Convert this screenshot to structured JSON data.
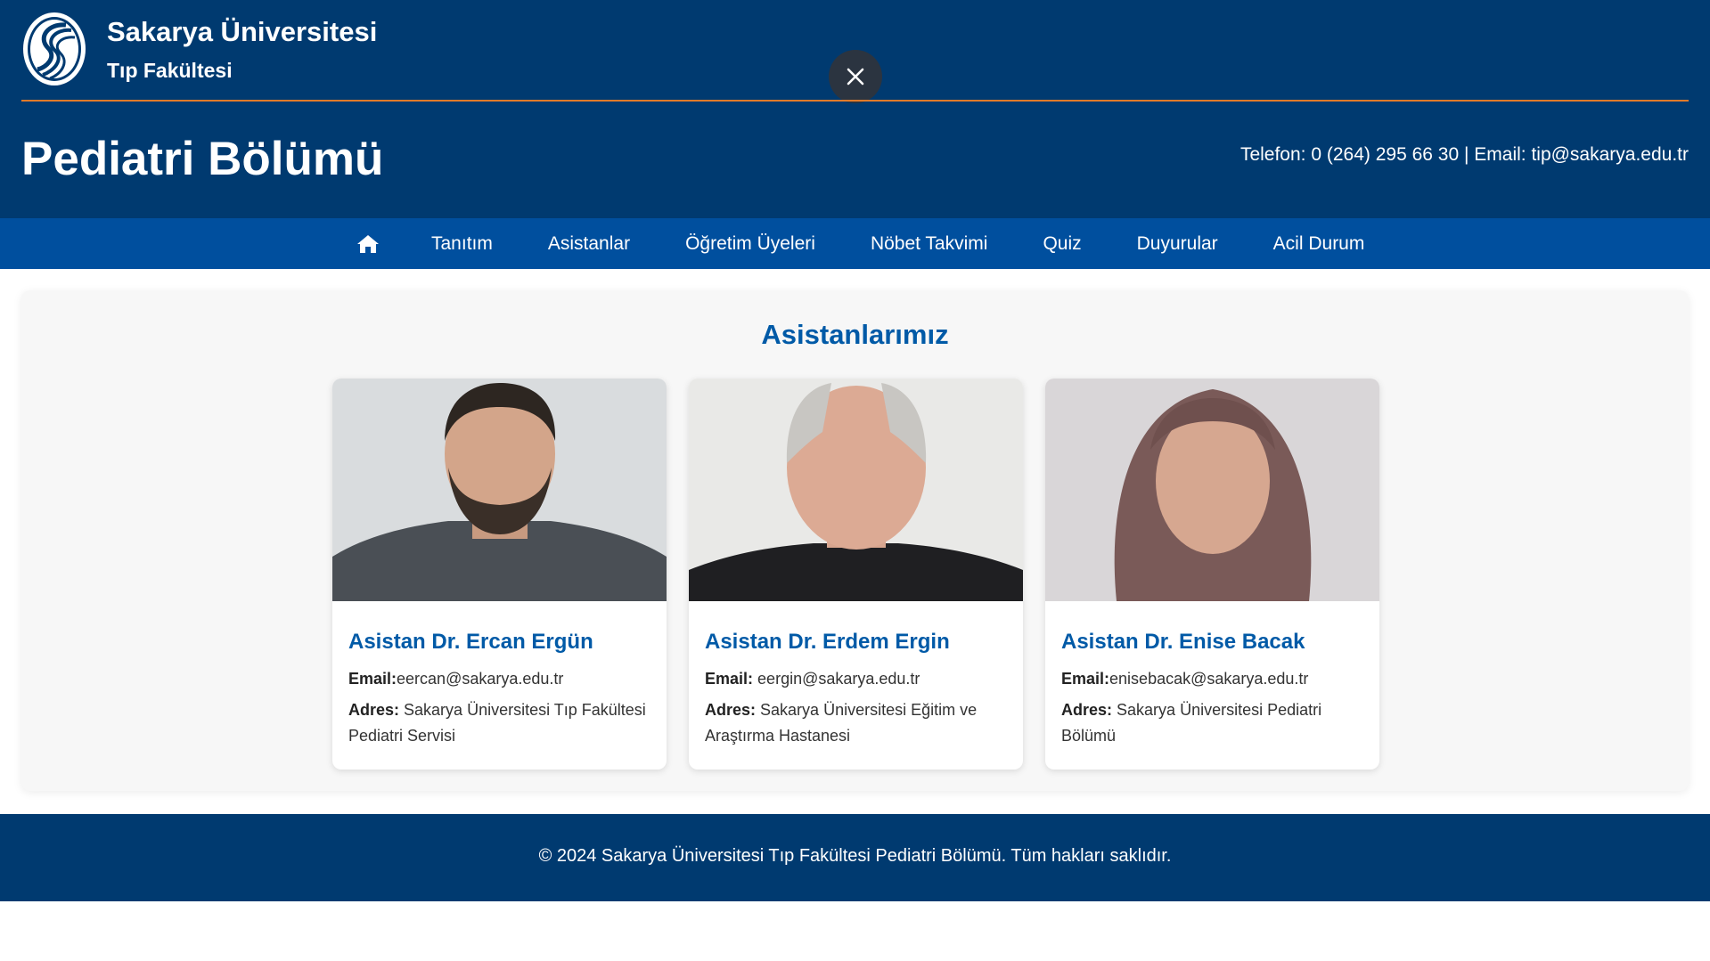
{
  "header": {
    "university": "Sakarya Üniversitesi",
    "faculty": "Tıp Fakültesi",
    "department_title": "Pediatri Bölümü",
    "contact": "Telefon: 0 (264) 295 66 30 | Email: tip@sakarya.edu.tr"
  },
  "nav": {
    "home_icon": "home-icon",
    "items": [
      {
        "label": "Tanıtım"
      },
      {
        "label": "Asistanlar"
      },
      {
        "label": "Öğretim Üyeleri"
      },
      {
        "label": "Nöbet Takvimi"
      },
      {
        "label": "Quiz"
      },
      {
        "label": "Duyurular"
      },
      {
        "label": "Acil Durum"
      }
    ]
  },
  "main": {
    "title": "Asistanlarımız",
    "cards": [
      {
        "name": "Asistan Dr. Ercan Ergün",
        "email_label": "Email:",
        "email": "eercan@sakarya.edu.tr",
        "address_label": "Adres:",
        "address": "Sakarya Üniversitesi Tıp Fakültesi Pediatri Servisi"
      },
      {
        "name": "Asistan Dr. Erdem Ergin",
        "email_label": "Email:",
        "email": "eergin@sakarya.edu.tr",
        "address_label": "Adres:",
        "address": "Sakarya Üniversitesi Eğitim ve Araştırma Hastanesi"
      },
      {
        "name": "Asistan Dr. Enise Bacak",
        "email_label": "Email:",
        "email": "enisebacak@sakarya.edu.tr",
        "address_label": "Adres:",
        "address": "Sakarya Üniversitesi Pediatri Bölümü"
      }
    ]
  },
  "footer": {
    "text": "© 2024 Sakarya Üniversitesi Tıp Fakültesi Pediatri Bölümü. Tüm hakları saklıdır."
  },
  "colors": {
    "header_bg": "#003a70",
    "nav_bg": "#004f9e",
    "accent_line": "#e07a2a",
    "title_blue": "#005aa7"
  }
}
